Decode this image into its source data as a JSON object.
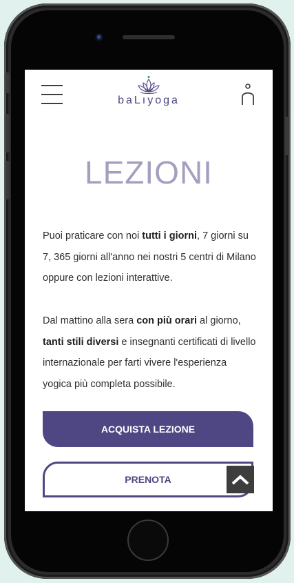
{
  "header": {
    "logo_text": "baLıyoga"
  },
  "page": {
    "title": "LEZIONI",
    "paragraph1": [
      {
        "text": "Puoi praticare con noi ",
        "bold": false
      },
      {
        "text": "tutti i giorni",
        "bold": true
      },
      {
        "text": ", 7 giorni su 7, 365 giorni all'anno nei nostri 5 centri di Milano oppure con lezioni interattive.",
        "bold": false
      }
    ],
    "paragraph2": [
      {
        "text": "Dal mattino alla sera ",
        "bold": false
      },
      {
        "text": "con più orari",
        "bold": true
      },
      {
        "text": " al giorno, ",
        "bold": false
      },
      {
        "text": "tanti stili diversi",
        "bold": true
      },
      {
        "text": " e insegnanti certificati di livello internazionale per farti vivere l'esperienza yogica più completa possibile.",
        "bold": false
      }
    ]
  },
  "actions": {
    "buy_label": "ACQUISTA LEZIONE",
    "book_label": "PRENOTA"
  },
  "colors": {
    "brand": "#4e4783",
    "title": "#a39fbe",
    "background": "#e1f1ee",
    "logo_dot": "#2aa879"
  },
  "icons": {
    "menu": "hamburger-icon",
    "logo": "lotus-icon",
    "user": "user-icon",
    "scroll_top": "chevron-up-icon"
  }
}
